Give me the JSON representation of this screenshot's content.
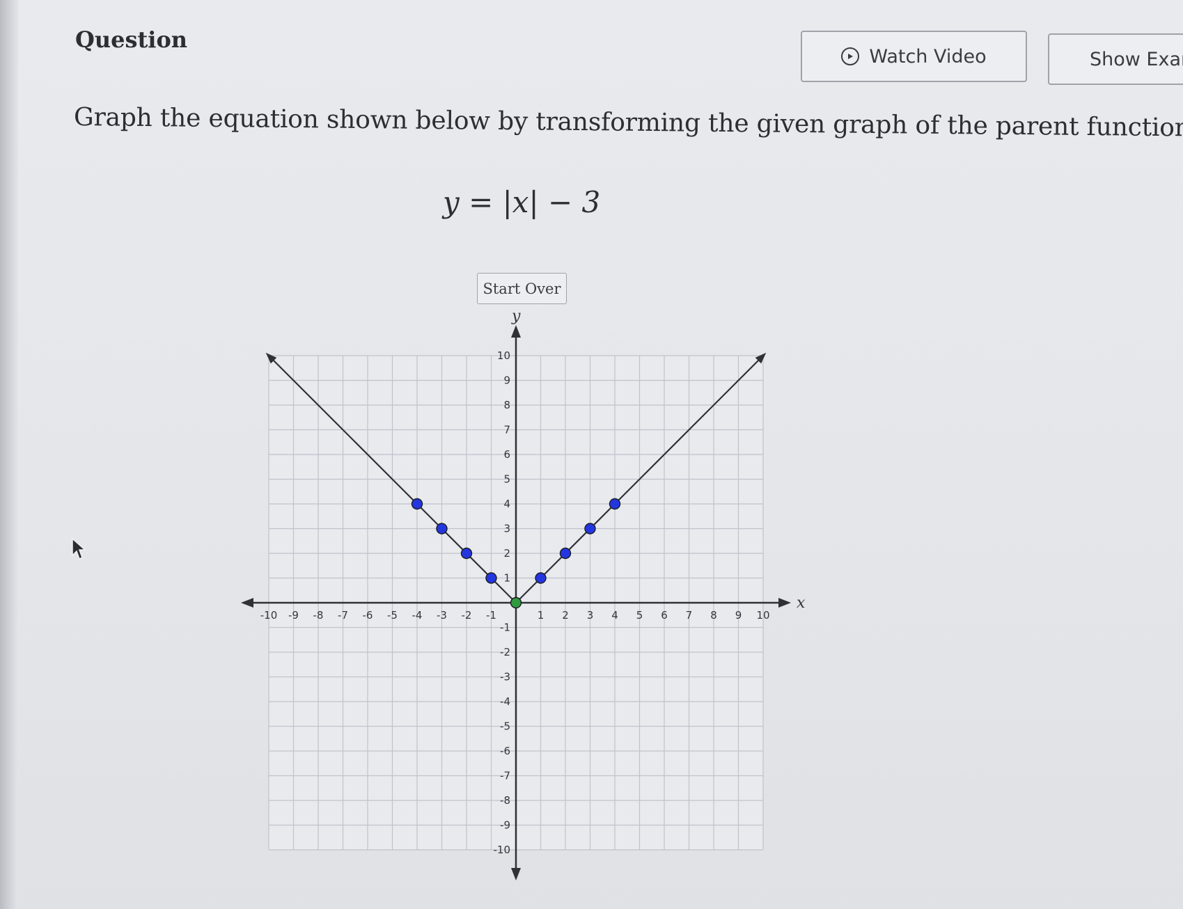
{
  "header": {
    "title": "Question",
    "watch_video_label": "Watch Video",
    "show_example_label": "Show Exan"
  },
  "question": {
    "prompt": "Graph the equation shown below by transforming the given graph of the parent function.",
    "equation": "y = |x| − 3",
    "start_over_label": "Start Over"
  },
  "icons": {
    "watch_video": "play-circle-icon",
    "cursor": "mouse-pointer-icon"
  },
  "colors": {
    "point_fill": "#2336e0",
    "vertex_fill": "#2f9a3f",
    "line": "#2f3136",
    "grid": "#bfc3c9"
  },
  "chart_data": {
    "type": "line",
    "title": "",
    "xlabel": "x",
    "ylabel": "y",
    "xlim": [
      -10,
      10
    ],
    "ylim": [
      -10,
      10
    ],
    "grid": true,
    "x_ticks": [
      -10,
      -9,
      -8,
      -7,
      -6,
      -5,
      -4,
      -3,
      -2,
      -1,
      1,
      2,
      3,
      4,
      5,
      6,
      7,
      8,
      9,
      10
    ],
    "y_ticks": [
      -10,
      -9,
      -8,
      -7,
      -6,
      -5,
      -4,
      -3,
      -2,
      -1,
      1,
      2,
      3,
      4,
      5,
      6,
      7,
      8,
      9,
      10
    ],
    "series": [
      {
        "values": [
          [
            -10,
            10
          ],
          [
            0,
            0
          ],
          [
            10,
            10
          ]
        ]
      }
    ],
    "points": [
      {
        "x": -4,
        "y": 4,
        "kind": "movable"
      },
      {
        "x": -3,
        "y": 3,
        "kind": "movable"
      },
      {
        "x": -2,
        "y": 2,
        "kind": "movable"
      },
      {
        "x": -1,
        "y": 1,
        "kind": "movable"
      },
      {
        "x": 0,
        "y": 0,
        "kind": "vertex"
      },
      {
        "x": 1,
        "y": 1,
        "kind": "movable"
      },
      {
        "x": 2,
        "y": 2,
        "kind": "movable"
      },
      {
        "x": 3,
        "y": 3,
        "kind": "movable"
      },
      {
        "x": 4,
        "y": 4,
        "kind": "movable"
      }
    ]
  }
}
